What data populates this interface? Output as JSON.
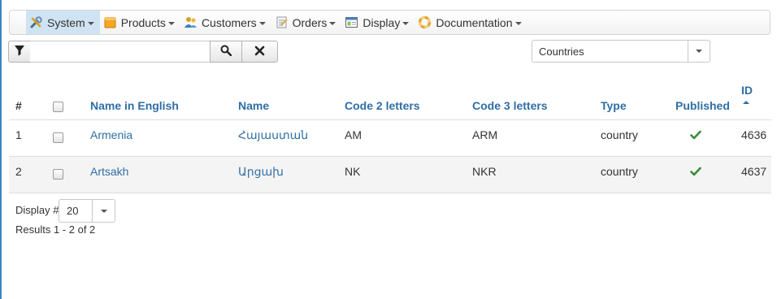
{
  "menu": {
    "items": [
      {
        "label": "System",
        "icon": "tools-icon",
        "active": true
      },
      {
        "label": "Products",
        "icon": "box-icon"
      },
      {
        "label": "Customers",
        "icon": "users-icon"
      },
      {
        "label": "Orders",
        "icon": "orders-icon"
      },
      {
        "label": "Display",
        "icon": "display-icon"
      },
      {
        "label": "Documentation",
        "icon": "lifebuoy-icon"
      }
    ]
  },
  "search": {
    "value": "",
    "placeholder": ""
  },
  "filter_select": {
    "value": "Countries"
  },
  "table": {
    "headers": {
      "num": "#",
      "name_english": "Name in English",
      "name": "Name",
      "code2": "Code 2 letters",
      "code3": "Code 3 letters",
      "type": "Type",
      "published": "Published",
      "id": "ID"
    },
    "rows": [
      {
        "num": "1",
        "name_english": "Armenia",
        "name": "Հայաստան",
        "code2": "AM",
        "code3": "ARM",
        "type": "country",
        "published": true,
        "id": "4636"
      },
      {
        "num": "2",
        "name_english": "Artsakh",
        "name": "Արցախ",
        "code2": "NK",
        "code3": "NKR",
        "type": "country",
        "published": true,
        "id": "4637"
      }
    ]
  },
  "footer": {
    "display_label": "Display #",
    "limit_value": "20",
    "results_text": "Results 1 - 2 of 2"
  },
  "colors": {
    "accent": "#2f6ea5",
    "published": "#3c8a3c",
    "active_menu": "#cfe3f3"
  }
}
